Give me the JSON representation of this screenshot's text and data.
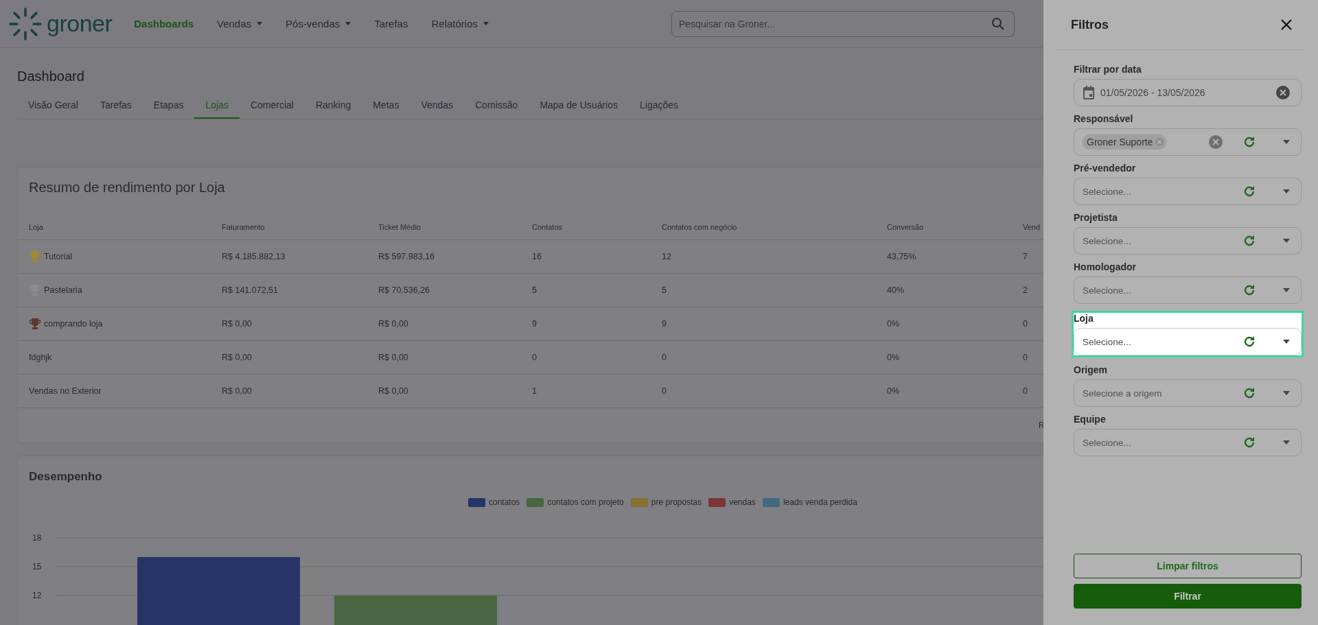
{
  "header": {
    "logo_text": "groner",
    "nav": [
      {
        "label": "Dashboards",
        "selected": true,
        "dropdown": false
      },
      {
        "label": "Vendas",
        "selected": false,
        "dropdown": true
      },
      {
        "label": "Pós-vendas",
        "selected": false,
        "dropdown": true
      },
      {
        "label": "Tarefas",
        "selected": false,
        "dropdown": false
      },
      {
        "label": "Relatórios",
        "selected": false,
        "dropdown": true
      }
    ],
    "search": {
      "placeholder": "Pesquisar na Groner..."
    }
  },
  "page": {
    "title": "Dashboard",
    "tabs": [
      {
        "label": "Visão Geral",
        "selected": false
      },
      {
        "label": "Tarefas",
        "selected": false
      },
      {
        "label": "Etapas",
        "selected": false
      },
      {
        "label": "Lojas",
        "selected": true
      },
      {
        "label": "Comercial",
        "selected": false
      },
      {
        "label": "Ranking",
        "selected": false
      },
      {
        "label": "Metas",
        "selected": false
      },
      {
        "label": "Vendas",
        "selected": false
      },
      {
        "label": "Comissão",
        "selected": false
      },
      {
        "label": "Mapa de Usuários",
        "selected": false
      },
      {
        "label": "Ligações",
        "selected": false
      }
    ]
  },
  "summary": {
    "title": "Resumo de rendimento por Loja",
    "columns": [
      "Loja",
      "Faturamento",
      "Ticket Médio",
      "Contatos",
      "Contatos com negócio",
      "Conversão",
      "Vend"
    ],
    "rows": [
      {
        "color": "#a08a2a",
        "cells": [
          "Tutorial",
          "R$ 4.185.882,13",
          "R$ 597.983,16",
          "16",
          "12",
          "43,75%",
          "7"
        ]
      },
      {
        "color": "#8c8c8c",
        "cells": [
          "Pastelaria",
          "R$ 141.072,51",
          "R$ 70.536,26",
          "5",
          "5",
          "40%",
          "2"
        ]
      },
      {
        "color": "#5a3a2c",
        "cells": [
          "comprando loja",
          "R$ 0,00",
          "R$ 0,00",
          "9",
          "9",
          "0%",
          "0"
        ]
      },
      {
        "cells": [
          "fdghjk",
          "R$ 0,00",
          "R$ 0,00",
          "0",
          "0",
          "0%",
          "0"
        ]
      },
      {
        "cells": [
          "Vendas no Exterior",
          "R$ 0,00",
          "R$ 0,00",
          "1",
          "0",
          "0%",
          "0"
        ]
      }
    ],
    "footer_text": "R"
  },
  "performance": {
    "title": "Desempenho",
    "chart_data": {
      "type": "bar",
      "grid": true,
      "ylim": [
        0,
        18
      ],
      "yticks": [
        12,
        15,
        18
      ],
      "series": [
        {
          "name": "contatos",
          "color": "#263566",
          "values": [
            16
          ]
        },
        {
          "name": "contatos com projeto",
          "color": "#476641",
          "values": [
            12
          ]
        },
        {
          "name": "pre propostas",
          "color": "#85702f",
          "values": [
            null
          ]
        },
        {
          "name": "vendas",
          "color": "#7d3535",
          "values": [
            null
          ]
        },
        {
          "name": "leads venda perdida",
          "color": "#3f6a80",
          "values": [
            null
          ]
        }
      ]
    }
  },
  "filters": {
    "title": "Filtros",
    "fields": [
      {
        "kind": "date",
        "label": "Filtrar por data",
        "value": "01/05/2026 - 13/05/2026",
        "focused": false
      },
      {
        "kind": "select",
        "label": "Responsável",
        "chips": [
          "Groner Suporte"
        ],
        "focused": false
      },
      {
        "kind": "select",
        "label": "Pré-vendedor",
        "placeholder": "Selecione...",
        "focused": false
      },
      {
        "kind": "select",
        "label": "Projetista",
        "placeholder": "Selecione...",
        "focused": false
      },
      {
        "kind": "select",
        "label": "Homologador",
        "placeholder": "Selecione...",
        "focused": false
      },
      {
        "kind": "select",
        "label": "Loja",
        "placeholder": "Selecione...",
        "focused": true
      },
      {
        "kind": "select",
        "label": "Origem",
        "placeholder": "Selecione a origem",
        "focused": false
      },
      {
        "kind": "select",
        "label": "Equipe",
        "placeholder": "Selecione...",
        "focused": false
      }
    ],
    "buttons": [
      {
        "kind": "outline",
        "label": "Limpar filtros"
      },
      {
        "kind": "primary",
        "label": "Filtrar"
      }
    ]
  }
}
